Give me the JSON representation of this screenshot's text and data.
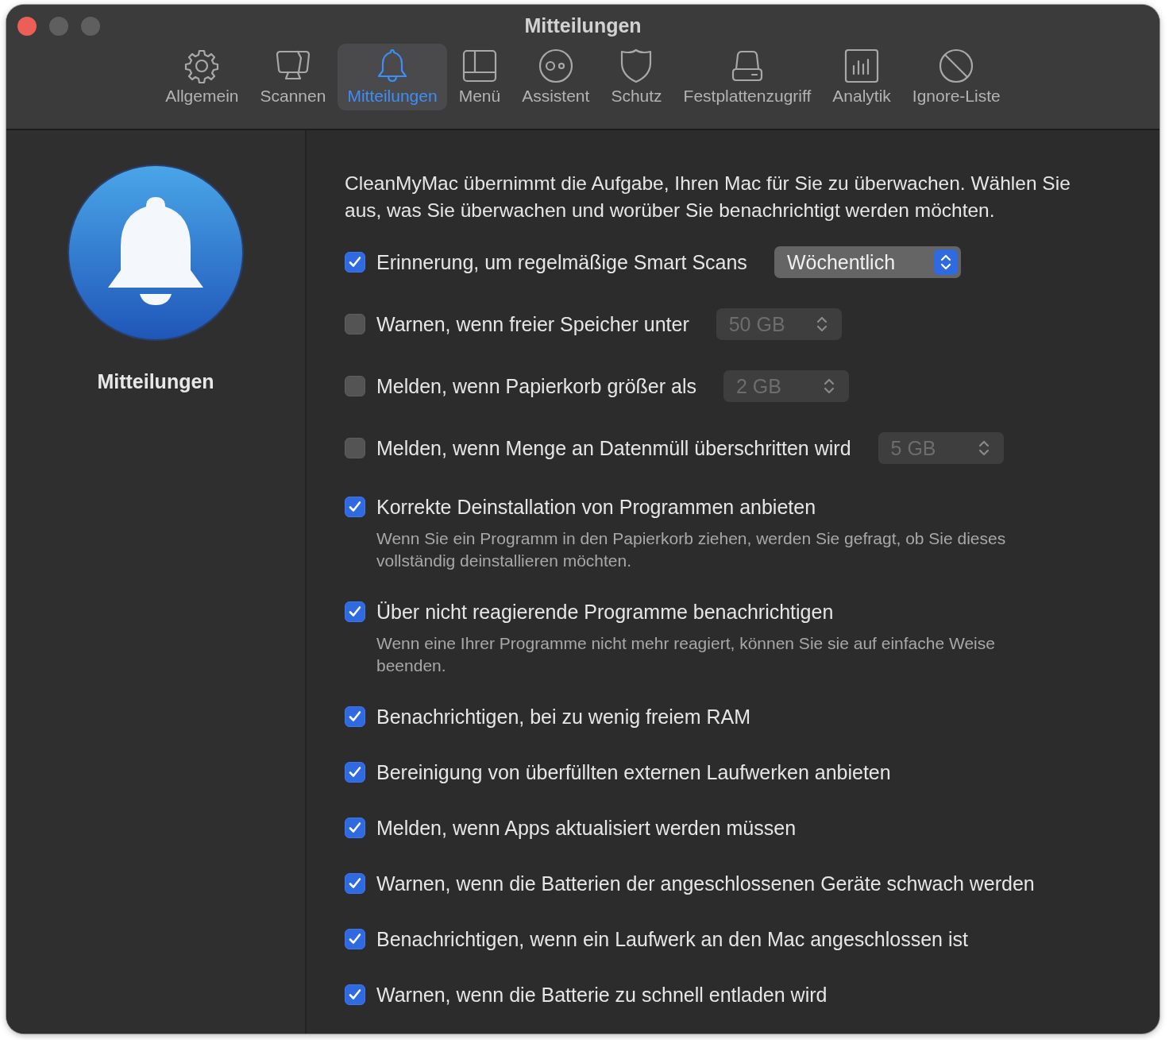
{
  "window": {
    "title": "Mitteilungen"
  },
  "tabs": [
    {
      "label": "Allgemein",
      "selected": false
    },
    {
      "label": "Scannen",
      "selected": false
    },
    {
      "label": "Mitteilungen",
      "selected": true
    },
    {
      "label": "Menü",
      "selected": false
    },
    {
      "label": "Assistent",
      "selected": false
    },
    {
      "label": "Schutz",
      "selected": false
    },
    {
      "label": "Festplattenzugriff",
      "selected": false
    },
    {
      "label": "Analytik",
      "selected": false
    },
    {
      "label": "Ignore-Liste",
      "selected": false
    }
  ],
  "sidebar": {
    "title": "Mitteilungen"
  },
  "intro": "CleanMyMac übernimmt die Aufgabe, Ihren Mac für Sie zu überwachen. Wählen Sie aus, was Sie überwachen und worüber Sie benachrichtigt werden möchten.",
  "options": [
    {
      "label": "Erinnerung, um regelmäßige Smart Scans",
      "checked": true,
      "popup": {
        "value": "Wöchentlich",
        "disabled": false
      }
    },
    {
      "label": "Warnen, wenn freier Speicher unter",
      "checked": false,
      "popup": {
        "value": "50 GB",
        "disabled": true
      }
    },
    {
      "label": "Melden, wenn Papierkorb größer als",
      "checked": false,
      "popup": {
        "value": "2 GB",
        "disabled": true
      }
    },
    {
      "label": "Melden, wenn Menge an Datenmüll überschritten wird",
      "checked": false,
      "popup": {
        "value": "5 GB",
        "disabled": true
      }
    },
    {
      "label": "Korrekte Deinstallation von Programmen anbieten",
      "checked": true,
      "description": "Wenn Sie ein Programm in den Papierkorb ziehen, werden Sie gefragt, ob Sie dieses vollständig deinstallieren möchten."
    },
    {
      "label": "Über nicht reagierende Programme benachrichtigen",
      "checked": true,
      "description": "Wenn eine Ihrer Programme nicht mehr reagiert, können Sie sie auf einfache Weise beenden."
    },
    {
      "label": "Benachrichtigen, bei zu wenig freiem RAM",
      "checked": true
    },
    {
      "label": "Bereinigung von überfüllten externen Laufwerken anbieten",
      "checked": true
    },
    {
      "label": "Melden, wenn Apps aktualisiert werden müssen",
      "checked": true
    },
    {
      "label": "Warnen, wenn die Batterien der angeschlossenen Geräte schwach werden",
      "checked": true
    },
    {
      "label": "Benachrichtigen, wenn ein Laufwerk an den Mac angeschlossen ist",
      "checked": true
    },
    {
      "label": "Warnen, wenn die Batterie zu schnell entladen wird",
      "checked": true
    }
  ]
}
